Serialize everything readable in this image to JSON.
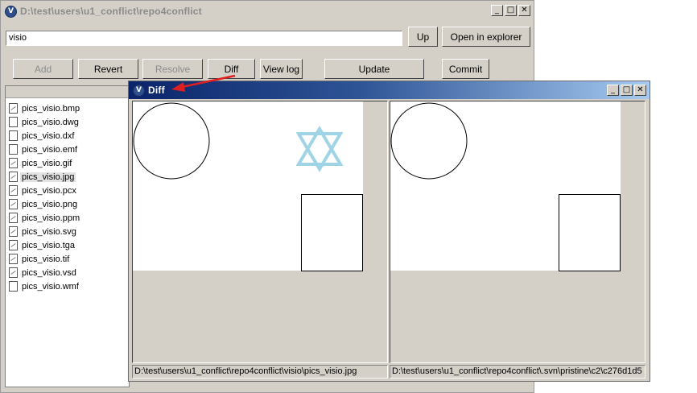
{
  "main_window": {
    "title": "D:\\test\\users\\u1_conflict\\repo4conflict",
    "path_value": "visio",
    "up_label": "Up",
    "explorer_label": "Open in explorer",
    "toolbar": {
      "add": "Add",
      "revert": "Revert",
      "resolve": "Resolve",
      "diff": "Diff",
      "view_log": "View log",
      "update": "Update",
      "commit": "Commit"
    },
    "files": [
      {
        "name": "pics_visio.bmp",
        "icon": "image-file-icon"
      },
      {
        "name": "pics_visio.dwg",
        "icon": "file-icon"
      },
      {
        "name": "pics_visio.dxf",
        "icon": "file-icon"
      },
      {
        "name": "pics_visio.emf",
        "icon": "file-icon"
      },
      {
        "name": "pics_visio.gif",
        "icon": "image-file-icon"
      },
      {
        "name": "pics_visio.jpg",
        "icon": "image-file-icon",
        "selected": true
      },
      {
        "name": "pics_visio.pcx",
        "icon": "image-file-icon"
      },
      {
        "name": "pics_visio.png",
        "icon": "image-file-icon"
      },
      {
        "name": "pics_visio.ppm",
        "icon": "image-file-icon"
      },
      {
        "name": "pics_visio.svg",
        "icon": "image-file-icon"
      },
      {
        "name": "pics_visio.tga",
        "icon": "image-file-icon"
      },
      {
        "name": "pics_visio.tif",
        "icon": "image-file-icon"
      },
      {
        "name": "pics_visio.vsd",
        "icon": "image-file-icon"
      },
      {
        "name": "pics_visio.wmf",
        "icon": "file-icon"
      }
    ]
  },
  "diff_window": {
    "title": "Diff",
    "left_path": "D:\\test\\users\\u1_conflict\\repo4conflict\\visio\\pics_visio.jpg",
    "right_path": "D:\\test\\users\\u1_conflict\\repo4conflict\\.svn\\pristine\\c2\\c276d1d5"
  },
  "colors": {
    "title_gradient_start": "#0a246a",
    "title_gradient_end": "#a6caf0",
    "star_color": "#9fd4e6",
    "arrow_color": "#e02020",
    "window_bg": "#d4d0c8"
  }
}
